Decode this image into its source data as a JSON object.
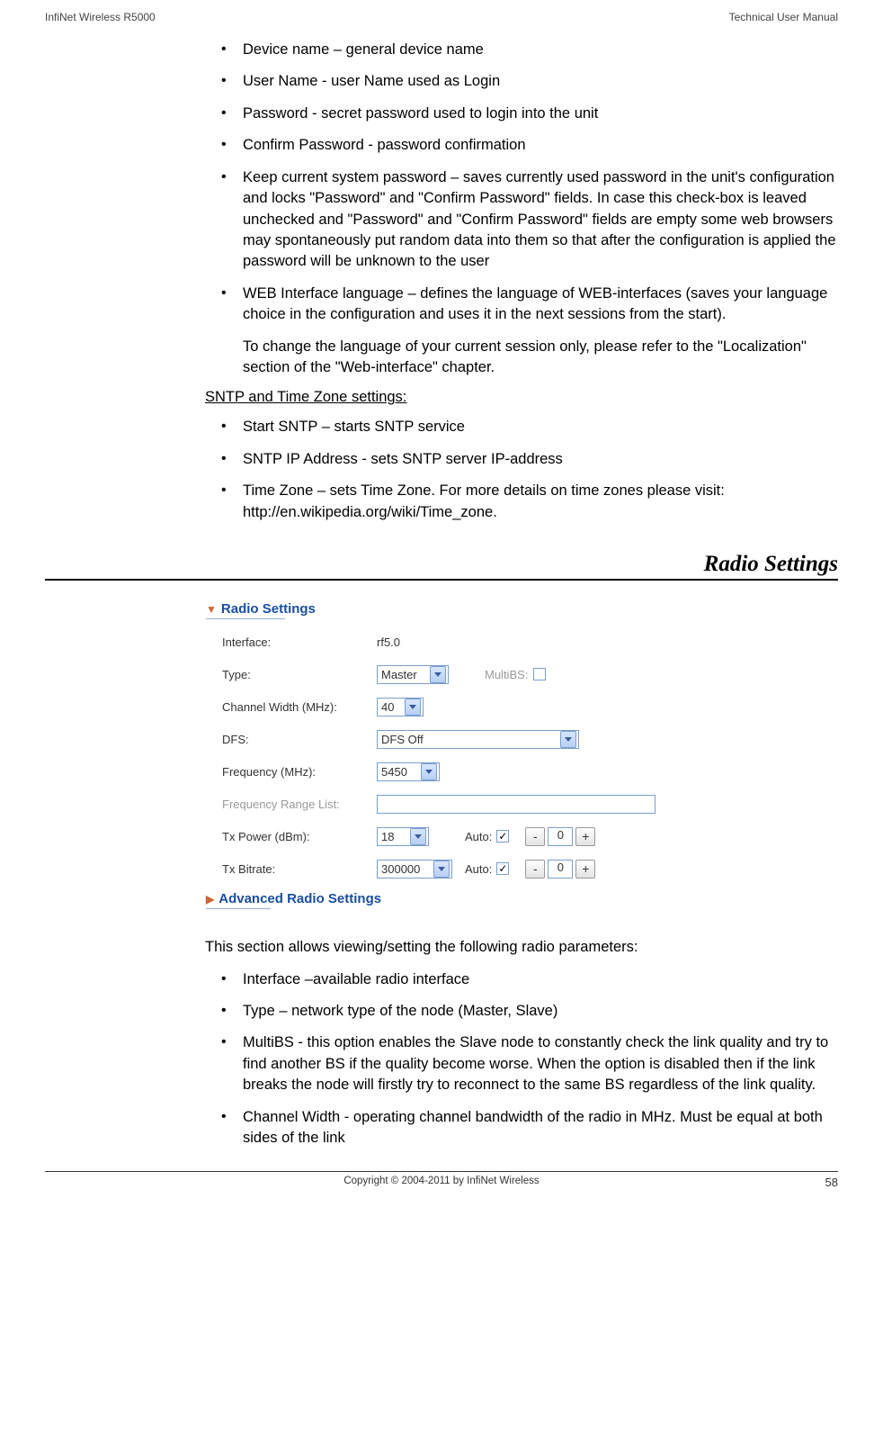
{
  "header": {
    "left": "InfiNet Wireless R5000",
    "right": "Technical User Manual"
  },
  "list1": {
    "i0": "Device name – general device name",
    "i1": "User Name - user Name used as Login",
    "i2": "Password - secret password used to login into the unit",
    "i3": "Confirm Password - password confirmation",
    "i4": "Keep current system password – saves currently used password in the unit's configuration and locks \"Password\" and \"Confirm Password\" fields. In case this check-box is leaved unchecked and \"Password\" and \"Confirm Password\" fields are empty some web browsers may spontaneously put random data into them so that after the configuration is applied the password will be unknown to the user",
    "i5": "WEB Interface language – defines the language of WEB-interfaces (saves your language choice in the configuration and uses it in the next sessions from the start).",
    "i5b": "To change the language of your current session only, please refer to the \"Localization\" section of the \"Web-interface\" chapter."
  },
  "sntp": {
    "heading": "SNTP and Time Zone settings:",
    "i0": "Start SNTP – starts SNTP service",
    "i1": "SNTP IP Address - sets SNTP server IP-address",
    "i2": "Time Zone – sets Time Zone. For more details on time zones please visit: http://en.wikipedia.org/wiki/Time_zone."
  },
  "section_title": "Radio Settings",
  "radio_ui": {
    "header": "Radio Settings",
    "advanced": "Advanced Radio Settings",
    "rows": {
      "interface": {
        "label": "Interface:",
        "value": "rf5.0"
      },
      "type": {
        "label": "Type:",
        "value": "Master",
        "multibs_label": "MultiBS:"
      },
      "cw": {
        "label": "Channel Width (MHz):",
        "value": "40"
      },
      "dfs": {
        "label": "DFS:",
        "value": "DFS Off"
      },
      "freq": {
        "label": "Frequency (MHz):",
        "value": "5450"
      },
      "frl": {
        "label": "Frequency Range List:"
      },
      "txp": {
        "label": "Tx Power (dBm):",
        "value": "18",
        "auto_label": "Auto:",
        "step_value": "0"
      },
      "txb": {
        "label": "Tx Bitrate:",
        "value": "300000",
        "auto_label": "Auto:",
        "step_value": "0"
      }
    }
  },
  "after_para": "This section allows viewing/setting the following radio parameters:",
  "list2": {
    "i0": "Interface –available radio interface",
    "i1": "Type – network type of the node (Master, Slave)",
    "i2": "MultiBS - this option enables the Slave node to constantly check the link quality and try to find another BS if the quality become worse. When the option is disabled then if the link breaks the node will firstly try to reconnect to the same BS regardless of the link quality.",
    "i3": "Channel Width - operating channel bandwidth of the radio in MHz. Must be equal at both sides of the link"
  },
  "footer": {
    "copyright": "Copyright © 2004-2011 by InfiNet Wireless",
    "page": "58"
  }
}
